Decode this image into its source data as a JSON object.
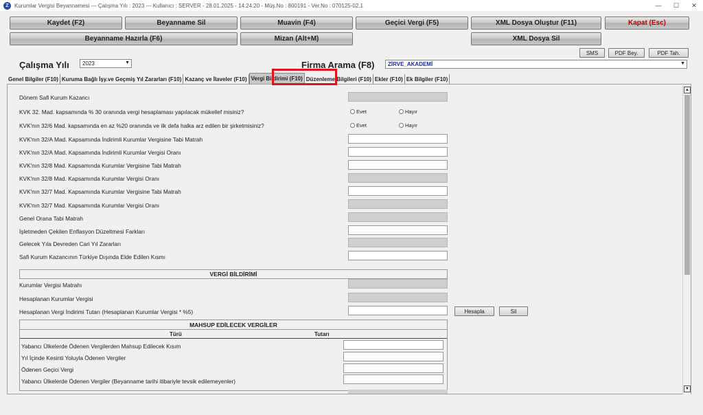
{
  "window": {
    "title": "Kurumlar Vergisi Beyannamesi  ---  Çalışma Yılı : 2023  ---  Kullanıcı : SERVER - 28.01.2025 - 14:24:20 - Müş.No : 800191 - Ver.No : 070125-02.1",
    "controls": {
      "minimize": "—",
      "maximize": "☐",
      "close": "✕"
    }
  },
  "toolbar": {
    "kaydet": "Kaydet (F2)",
    "beyanname_sil": "Beyanname Sil",
    "muavin": "Muavin (F4)",
    "gecici_vergi": "Geçici Vergi (F5)",
    "xml_olustur": "XML Dosya Oluştur (F11)",
    "kapat": "Kapat (Esc)",
    "beyanname_hazirla": "Beyanname Hazırla (F6)",
    "mizan": "Mizan (Alt+M)",
    "xml_sil": "XML Dosya Sil",
    "sms": "SMS",
    "pdf_bey": "PDF Bey.",
    "pdf_tah": "PDF Tah."
  },
  "header": {
    "calisma_yili_label": "Çalışma Yılı",
    "calisma_yili_value": "2023",
    "firma_arama_label": "Firma Arama (F8)",
    "firma_value": "ZİRVE_AKADEMİ"
  },
  "tabs": [
    {
      "label": "Genel Bilgiler (F10)"
    },
    {
      "label": "Kuruma Bağlı İşy.ve Geçmiş Yıl Zararları (F10)"
    },
    {
      "label": "Kazanç ve İlaveler (F10)"
    },
    {
      "label": "Vergi Bildirimi (F10)"
    },
    {
      "label": "Düzenleme Bilgileri (F10)"
    },
    {
      "label": "Ekler (F10)"
    },
    {
      "label": "Ek Bilgiler (F10)"
    }
  ],
  "form": {
    "rows": [
      {
        "label": "Dönem Safi Kurum Kazancı"
      },
      {
        "label": "KVK 32. Mad. kapsamında % 30 oranında vergi hesaplaması yapılacak mükellef misiniz?"
      },
      {
        "label": "KVK'nın 32/6 Mad. kapsamında en az %20 oranında ve ilk defa halka arz edilen bir şirketmisiniz?"
      },
      {
        "label": "KVK'nın 32/A Mad. Kapsamında İndirimli Kurumlar Vergisine Tabi Matrah"
      },
      {
        "label": "KVK'nın 32/A Mad. Kapsamında İndirimli Kurumlar Vergisi Oranı"
      },
      {
        "label": "KVK'nın 32/8 Mad. Kapsamında Kurumlar Vergisine Tabi Matrah"
      },
      {
        "label": "KVK'nın 32/8 Mad. Kapsamında Kurumlar Vergisi Oranı"
      },
      {
        "label": "KVK'nın 32/7 Mad. Kapsamında Kurumlar Vergisine Tabi Matrah"
      },
      {
        "label": "KVK'nın 32/7 Mad. Kapsamında Kurumlar Vergisi Oranı"
      },
      {
        "label": "Genel Orana Tabi Matrah"
      },
      {
        "label": "İşletmeden Çekilen Enflasyon Düzeltmesi Farkları"
      },
      {
        "label": "Gelecek Yıla Devreden Cari Yıl Zararları"
      },
      {
        "label": "Safi Kurum Kazancının Türkiye Dışında Elde Edilen Kısmı"
      }
    ],
    "radio_evet": "Evet",
    "radio_hayir": "Hayır",
    "vergi_bildirimi_header": "VERGİ BİLDİRİMİ",
    "vb_rows": [
      {
        "label": "Kurumlar Vergisi Matrahı"
      },
      {
        "label": "Hesaplanan Kurumlar Vergisi"
      },
      {
        "label": "Hesaplanan Vergi İndirimi Tutarı (Hesaplanan Kurumlar Vergisi * %5)"
      }
    ],
    "hesapla": "Hesapla",
    "sil": "Sil",
    "mahsup_header": "MAHSUP EDİLECEK VERGİLER",
    "col_turu": "Türü",
    "col_tutari": "Tutarı",
    "mahsup_rows": [
      {
        "label": "Yabancı Ülkelerde Ödenen Vergilerden Mahsup Edilecek Kısım"
      },
      {
        "label": "Yıl İçinde Kesinti Yoluyla Ödenen Vergiler"
      },
      {
        "label": "Ödenen Geçici Vergi"
      },
      {
        "label": "Yabancı Ülkelerde Ödenen Vergiler (Beyanname tarihi itibariyle tevsik edilemeyenler)"
      }
    ]
  }
}
